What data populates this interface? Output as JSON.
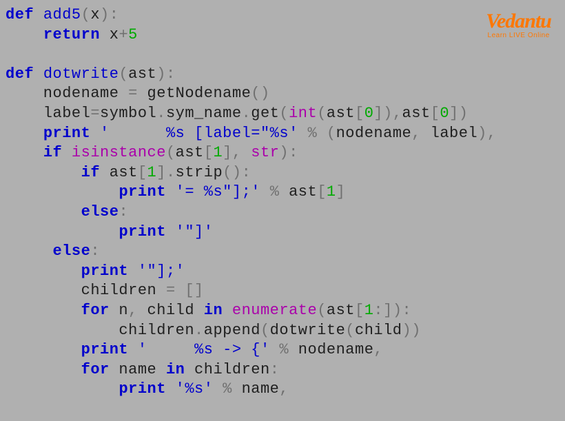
{
  "logo": {
    "brand": "Vedantu",
    "tagline": "Learn LIVE Online"
  },
  "code": {
    "lines": [
      {
        "segments": [
          {
            "c": "kw",
            "t": "def"
          },
          {
            "c": "txt",
            "t": " "
          },
          {
            "c": "fn",
            "t": "add5"
          },
          {
            "c": "paren",
            "t": "("
          },
          {
            "c": "txt",
            "t": "x"
          },
          {
            "c": "paren",
            "t": ")"
          },
          {
            "c": "op",
            "t": ":"
          }
        ]
      },
      {
        "segments": [
          {
            "c": "txt",
            "t": "    "
          },
          {
            "c": "kw",
            "t": "return"
          },
          {
            "c": "txt",
            "t": " x"
          },
          {
            "c": "op",
            "t": "+"
          },
          {
            "c": "num",
            "t": "5"
          }
        ]
      },
      {
        "segments": []
      },
      {
        "segments": [
          {
            "c": "kw",
            "t": "def"
          },
          {
            "c": "txt",
            "t": " "
          },
          {
            "c": "fn",
            "t": "dotwrite"
          },
          {
            "c": "paren",
            "t": "("
          },
          {
            "c": "txt",
            "t": "ast"
          },
          {
            "c": "paren",
            "t": ")"
          },
          {
            "c": "op",
            "t": ":"
          }
        ]
      },
      {
        "segments": [
          {
            "c": "txt",
            "t": "    nodename "
          },
          {
            "c": "op",
            "t": "="
          },
          {
            "c": "txt",
            "t": " getNodename"
          },
          {
            "c": "paren",
            "t": "()"
          }
        ]
      },
      {
        "segments": [
          {
            "c": "txt",
            "t": "    label"
          },
          {
            "c": "op",
            "t": "="
          },
          {
            "c": "txt",
            "t": "symbol"
          },
          {
            "c": "op",
            "t": "."
          },
          {
            "c": "txt",
            "t": "sym_name"
          },
          {
            "c": "op",
            "t": "."
          },
          {
            "c": "txt",
            "t": "get"
          },
          {
            "c": "paren",
            "t": "("
          },
          {
            "c": "builtin",
            "t": "int"
          },
          {
            "c": "paren",
            "t": "("
          },
          {
            "c": "txt",
            "t": "ast"
          },
          {
            "c": "paren",
            "t": "["
          },
          {
            "c": "num",
            "t": "0"
          },
          {
            "c": "paren",
            "t": "])"
          },
          {
            "c": "op",
            "t": ","
          },
          {
            "c": "txt",
            "t": "ast"
          },
          {
            "c": "paren",
            "t": "["
          },
          {
            "c": "num",
            "t": "0"
          },
          {
            "c": "paren",
            "t": "])"
          }
        ]
      },
      {
        "segments": [
          {
            "c": "txt",
            "t": "    "
          },
          {
            "c": "kw",
            "t": "print"
          },
          {
            "c": "txt",
            "t": " "
          },
          {
            "c": "str",
            "t": "'      %s [label=\"%s'"
          },
          {
            "c": "txt",
            "t": " "
          },
          {
            "c": "op",
            "t": "%"
          },
          {
            "c": "txt",
            "t": " "
          },
          {
            "c": "paren",
            "t": "("
          },
          {
            "c": "txt",
            "t": "nodename"
          },
          {
            "c": "op",
            "t": ","
          },
          {
            "c": "txt",
            "t": " label"
          },
          {
            "c": "paren",
            "t": ")"
          },
          {
            "c": "op",
            "t": ","
          }
        ]
      },
      {
        "segments": [
          {
            "c": "txt",
            "t": "    "
          },
          {
            "c": "kw",
            "t": "if"
          },
          {
            "c": "txt",
            "t": " "
          },
          {
            "c": "builtin",
            "t": "isinstance"
          },
          {
            "c": "paren",
            "t": "("
          },
          {
            "c": "txt",
            "t": "ast"
          },
          {
            "c": "paren",
            "t": "["
          },
          {
            "c": "num",
            "t": "1"
          },
          {
            "c": "paren",
            "t": "]"
          },
          {
            "c": "op",
            "t": ","
          },
          {
            "c": "txt",
            "t": " "
          },
          {
            "c": "builtin",
            "t": "str"
          },
          {
            "c": "paren",
            "t": ")"
          },
          {
            "c": "op",
            "t": ":"
          }
        ]
      },
      {
        "segments": [
          {
            "c": "txt",
            "t": "        "
          },
          {
            "c": "kw",
            "t": "if"
          },
          {
            "c": "txt",
            "t": " ast"
          },
          {
            "c": "paren",
            "t": "["
          },
          {
            "c": "num",
            "t": "1"
          },
          {
            "c": "paren",
            "t": "]"
          },
          {
            "c": "op",
            "t": "."
          },
          {
            "c": "txt",
            "t": "strip"
          },
          {
            "c": "paren",
            "t": "()"
          },
          {
            "c": "op",
            "t": ":"
          }
        ]
      },
      {
        "segments": [
          {
            "c": "txt",
            "t": "            "
          },
          {
            "c": "kw",
            "t": "print"
          },
          {
            "c": "txt",
            "t": " "
          },
          {
            "c": "str",
            "t": "'= %s\"];'"
          },
          {
            "c": "txt",
            "t": " "
          },
          {
            "c": "op",
            "t": "%"
          },
          {
            "c": "txt",
            "t": " ast"
          },
          {
            "c": "paren",
            "t": "["
          },
          {
            "c": "num",
            "t": "1"
          },
          {
            "c": "paren",
            "t": "]"
          }
        ]
      },
      {
        "segments": [
          {
            "c": "txt",
            "t": "        "
          },
          {
            "c": "kw",
            "t": "else"
          },
          {
            "c": "op",
            "t": ":"
          }
        ]
      },
      {
        "segments": [
          {
            "c": "txt",
            "t": "            "
          },
          {
            "c": "kw",
            "t": "print"
          },
          {
            "c": "txt",
            "t": " "
          },
          {
            "c": "str",
            "t": "'\"]'"
          }
        ]
      },
      {
        "segments": [
          {
            "c": "txt",
            "t": "     "
          },
          {
            "c": "kw",
            "t": "else"
          },
          {
            "c": "op",
            "t": ":"
          }
        ]
      },
      {
        "segments": [
          {
            "c": "txt",
            "t": "        "
          },
          {
            "c": "kw",
            "t": "print"
          },
          {
            "c": "txt",
            "t": " "
          },
          {
            "c": "str",
            "t": "'\"];'"
          }
        ]
      },
      {
        "segments": [
          {
            "c": "txt",
            "t": "        children "
          },
          {
            "c": "op",
            "t": "="
          },
          {
            "c": "txt",
            "t": " "
          },
          {
            "c": "paren",
            "t": "[]"
          }
        ]
      },
      {
        "segments": [
          {
            "c": "txt",
            "t": "        "
          },
          {
            "c": "kw",
            "t": "for"
          },
          {
            "c": "txt",
            "t": " n"
          },
          {
            "c": "op",
            "t": ","
          },
          {
            "c": "txt",
            "t": " child "
          },
          {
            "c": "kw",
            "t": "in"
          },
          {
            "c": "txt",
            "t": " "
          },
          {
            "c": "builtin",
            "t": "enumerate"
          },
          {
            "c": "paren",
            "t": "("
          },
          {
            "c": "txt",
            "t": "ast"
          },
          {
            "c": "paren",
            "t": "["
          },
          {
            "c": "num",
            "t": "1"
          },
          {
            "c": "op",
            "t": ":"
          },
          {
            "c": "paren",
            "t": "])"
          },
          {
            "c": "op",
            "t": ":"
          }
        ]
      },
      {
        "segments": [
          {
            "c": "txt",
            "t": "            children"
          },
          {
            "c": "op",
            "t": "."
          },
          {
            "c": "txt",
            "t": "append"
          },
          {
            "c": "paren",
            "t": "("
          },
          {
            "c": "txt",
            "t": "dotwrite"
          },
          {
            "c": "paren",
            "t": "("
          },
          {
            "c": "txt",
            "t": "child"
          },
          {
            "c": "paren",
            "t": "))"
          }
        ]
      },
      {
        "segments": [
          {
            "c": "txt",
            "t": "        "
          },
          {
            "c": "kw",
            "t": "print"
          },
          {
            "c": "txt",
            "t": " "
          },
          {
            "c": "str",
            "t": "'     %s -> {'"
          },
          {
            "c": "txt",
            "t": " "
          },
          {
            "c": "op",
            "t": "%"
          },
          {
            "c": "txt",
            "t": " nodename"
          },
          {
            "c": "op",
            "t": ","
          }
        ]
      },
      {
        "segments": [
          {
            "c": "txt",
            "t": "        "
          },
          {
            "c": "kw",
            "t": "for"
          },
          {
            "c": "txt",
            "t": " name "
          },
          {
            "c": "kw",
            "t": "in"
          },
          {
            "c": "txt",
            "t": " children"
          },
          {
            "c": "op",
            "t": ":"
          }
        ]
      },
      {
        "segments": [
          {
            "c": "txt",
            "t": "            "
          },
          {
            "c": "kw",
            "t": "print"
          },
          {
            "c": "txt",
            "t": " "
          },
          {
            "c": "str",
            "t": "'%s'"
          },
          {
            "c": "txt",
            "t": " "
          },
          {
            "c": "op",
            "t": "%"
          },
          {
            "c": "txt",
            "t": " name"
          },
          {
            "c": "op",
            "t": ","
          }
        ]
      }
    ]
  }
}
